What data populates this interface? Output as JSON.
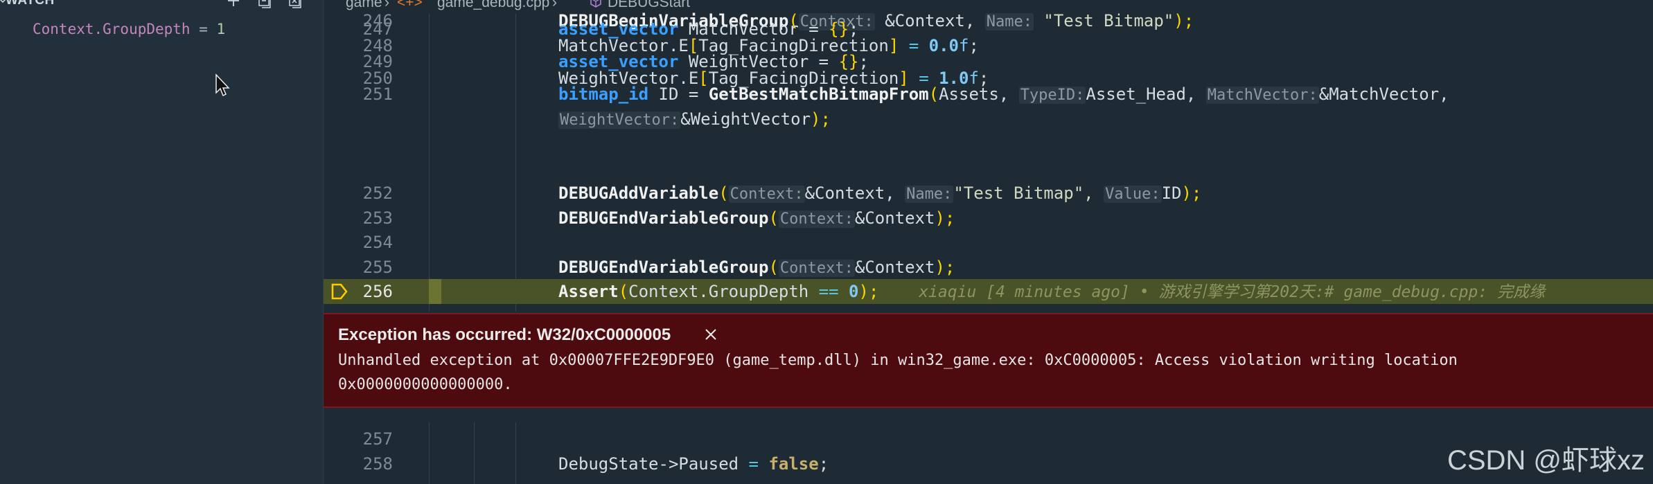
{
  "watch": {
    "title": "WATCH",
    "entry_name": "Context.GroupDepth",
    "entry_op": " = ",
    "entry_value": "1"
  },
  "breadcrumb": {
    "folder": "game",
    "file": "game_debug.cpp",
    "symbol": "DEBUGStart"
  },
  "code": {
    "l246": {
      "num": "246",
      "fn": "DEBUGBeginVariableGroup",
      "hint1": "Context:",
      "arg1": "&Context, ",
      "hint2": "Name:",
      "arg2": "\"Test Bitmap\"",
      "tail": ");"
    },
    "l247": {
      "num": "247",
      "type": "asset_vector",
      "rest": " MatchVector = ",
      "brace": "{}",
      "semi": ";"
    },
    "l248": {
      "num": "248",
      "lhs": "MatchVector.E",
      "idx": "Tag_FacingDirection",
      "eq": " = ",
      "val": "0.0",
      "suffix": "f",
      "semi": ";"
    },
    "l249": {
      "num": "249",
      "type": "asset_vector",
      "rest": " WeightVector = ",
      "brace": "{}",
      "semi": ";"
    },
    "l250": {
      "num": "250",
      "lhs": "WeightVector.E",
      "idx": "Tag_FacingDirection",
      "eq": " = ",
      "val": "1.0",
      "suffix": "f",
      "semi": ";"
    },
    "l251": {
      "num": "251",
      "type": "bitmap_id",
      "rest": " ID = ",
      "fn": "GetBestMatchBitmapFrom",
      "a1": "Assets, ",
      "h2": "TypeID:",
      "a2": "Asset_Head, ",
      "h3": "MatchVector:",
      "a3": "&MatchVector,",
      "h4": "WeightVector:",
      "a4": "&WeightVector",
      "tail": ");"
    },
    "l252": {
      "num": "252",
      "fn": "DEBUGAddVariable",
      "h1": "Context:",
      "a1": "&Context, ",
      "h2": "Name:",
      "a2": "\"Test Bitmap\", ",
      "h3": "Value:",
      "a3": "ID",
      "tail": ");"
    },
    "l253": {
      "num": "253",
      "fn": "DEBUGEndVariableGroup",
      "h1": "Context:",
      "a1": "&Context",
      "tail": ");"
    },
    "l254": {
      "num": "254"
    },
    "l255": {
      "num": "255",
      "fn": "DEBUGEndVariableGroup",
      "h1": "Context:",
      "a1": "&Context",
      "tail": ");"
    },
    "l256": {
      "num": "256",
      "fn": "Assert",
      "arg": "Context.GroupDepth",
      "op": " == ",
      "val": "0",
      "tail": ");",
      "blame": "xiaqiu [4 minutes ago] • 游戏引擎学习第202天:# game_debug.cpp: 完成缘"
    },
    "l257": {
      "num": "257"
    },
    "l258": {
      "num": "258",
      "lhs": "DebugState->Paused",
      "eq": " = ",
      "val": "false",
      "semi": ";"
    }
  },
  "exception": {
    "title": "Exception has occurred: W32/0xC0000005",
    "message_line1": "Unhandled exception at 0x00007FFE2E9DF9E0 (game_temp.dll) in win32_game.exe: 0xC0000005: Access violation writing location",
    "message_line2": "0x0000000000000000."
  },
  "watermark": "CSDN @虾球xz",
  "icons": [
    "chevron-down-icon",
    "add-icon",
    "collapse-all-icon",
    "remove-all-icon",
    "folder-chevron-icon",
    "file-code-icon",
    "symbol-method-icon",
    "breakpoint-arrow-icon",
    "close-icon",
    "mouse-cursor-icon"
  ],
  "colors": {
    "exception_bg": "#4e0b0f",
    "current_line": "#4a5227",
    "keyword": "#3aa0ff",
    "watch_name": "#c586c0"
  }
}
